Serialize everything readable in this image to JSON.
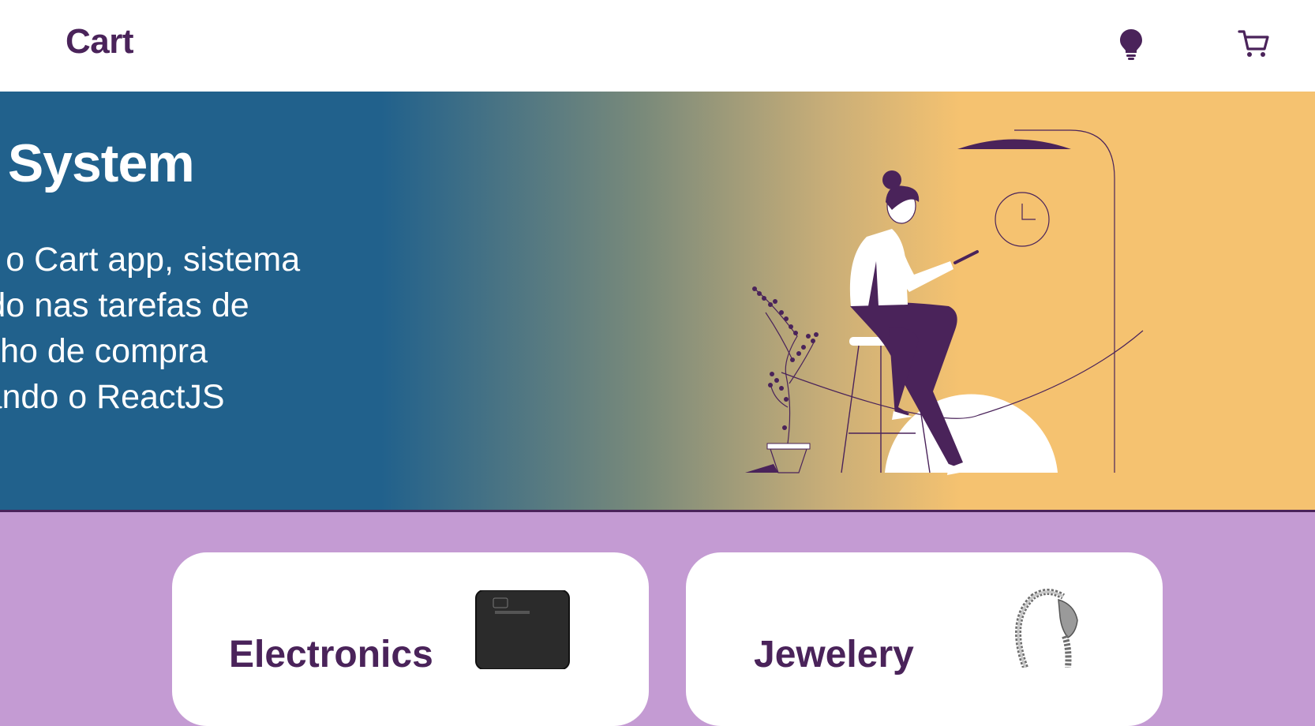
{
  "header": {
    "logo": "Cart",
    "icons": [
      "lightbulb-icon",
      "shopping-cart-icon"
    ]
  },
  "hero": {
    "title": "art System",
    "description": "ste o Cart app, sistema\ncado nas tarefas de\nrrinho de compra\nlizando o ReactJS"
  },
  "categories": [
    {
      "label": "Electronics",
      "image": "external-hard-drive"
    },
    {
      "label": "Jewelery",
      "image": "silver-dragon-bracelet"
    }
  ],
  "colors": {
    "brand": "#4a235a",
    "hero_blue": "#21618c",
    "hero_yellow": "#f5c270",
    "background": "#c49bd3"
  }
}
